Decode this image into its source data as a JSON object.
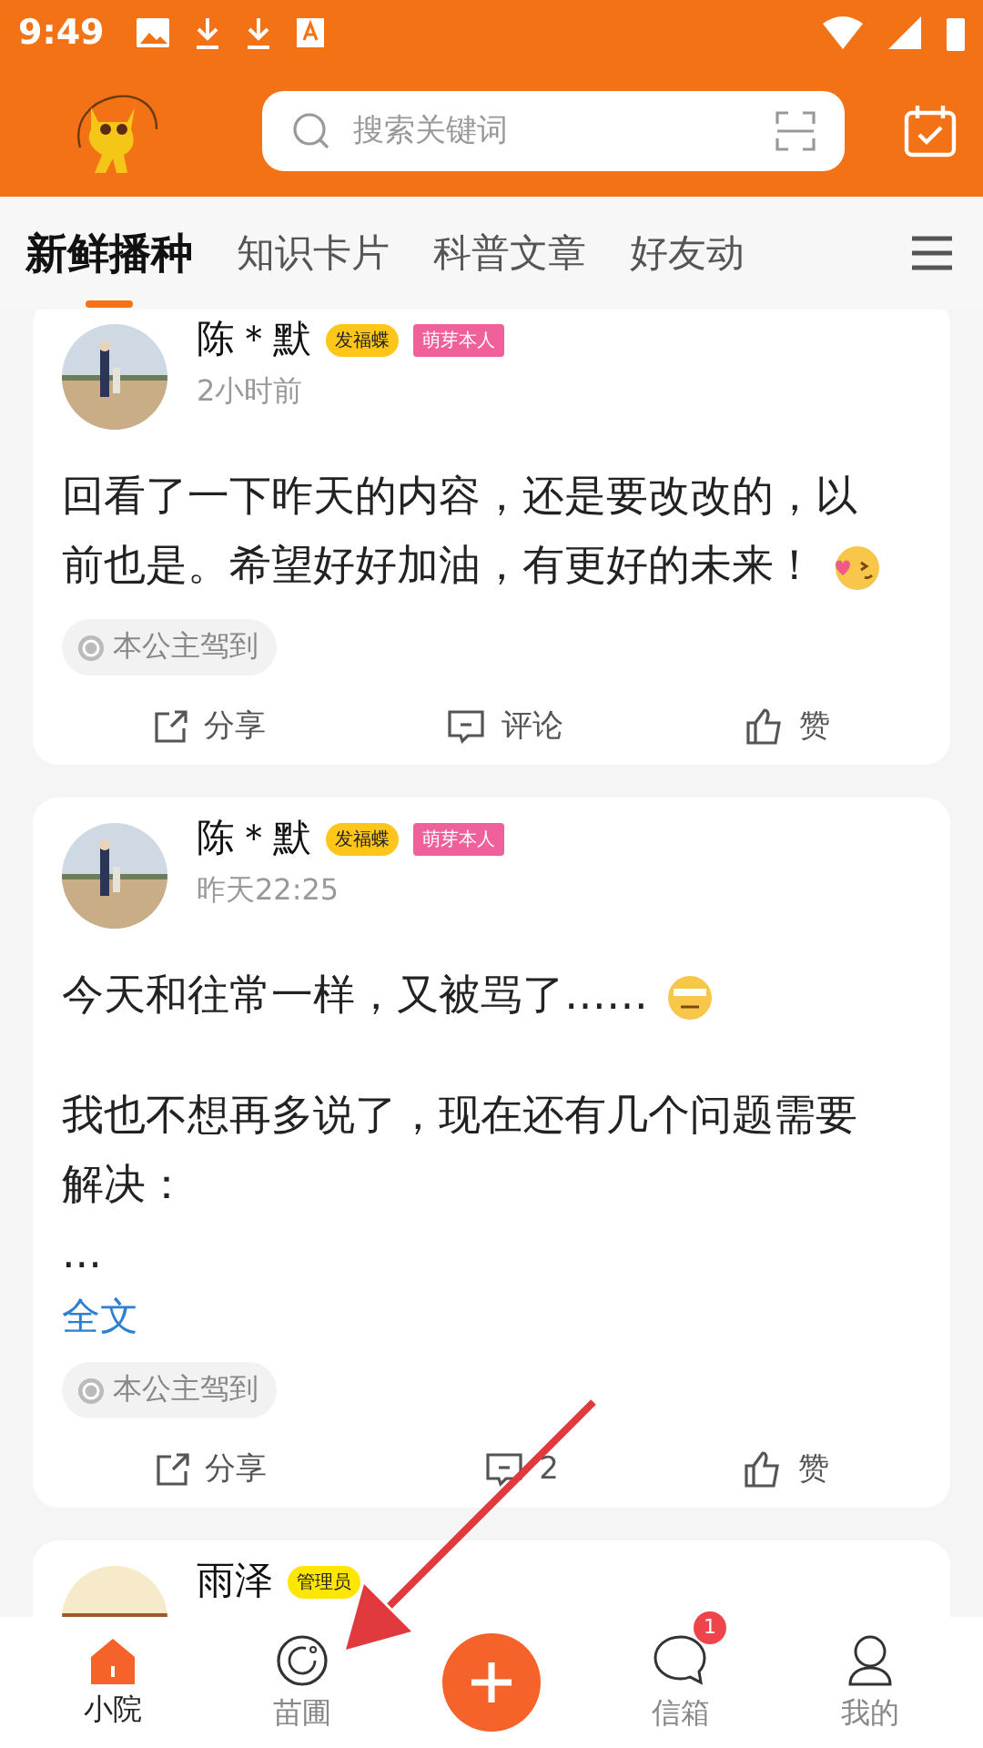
{
  "status_bar": {
    "time": "9:49"
  },
  "search": {
    "placeholder": "搜索关键词"
  },
  "tabs": [
    {
      "label": "新鲜播种",
      "selected": true
    },
    {
      "label": "知识卡片",
      "selected": false
    },
    {
      "label": "科普文章",
      "selected": false
    },
    {
      "label": "好友动",
      "selected": false
    }
  ],
  "posts": [
    {
      "author": "陈＊默",
      "badges": [
        {
          "kind": "medal",
          "label": "发福蝶"
        },
        {
          "kind": "crown",
          "label": "萌芽本人"
        }
      ],
      "time": "2小时前",
      "paragraphs": [
        {
          "text": "回看了一下昨天的内容，还是要改改的，以前也是。希望好好加油，有更好的未来！",
          "emoji": true
        }
      ],
      "tag": "本公主驾到",
      "actions": {
        "share": "分享",
        "comment": "评论",
        "like": "赞"
      }
    },
    {
      "author": "陈＊默",
      "badges": [
        {
          "kind": "medal",
          "label": "发福蝶"
        },
        {
          "kind": "crown",
          "label": "萌芽本人"
        }
      ],
      "time": "昨天22:25",
      "paragraphs": [
        {
          "text": "今天和往常一样，又被骂了……",
          "emoji": true
        },
        {
          "text": "我也不想再多说了，现在还有几个问题需要解决：\n...",
          "emoji": false
        }
      ],
      "more": "全文",
      "tag": "本公主驾到",
      "actions": {
        "share": "分享",
        "comment": "2",
        "like": "赞"
      }
    },
    {
      "author": "雨泽",
      "badges": [
        {
          "kind": "admin",
          "label": "管理员"
        }
      ]
    }
  ],
  "nav": [
    {
      "kind": "home",
      "label": "小院",
      "selected": true
    },
    {
      "kind": "nursery",
      "label": "苗圃",
      "selected": false
    },
    {
      "kind": "add"
    },
    {
      "kind": "inbox",
      "label": "信箱",
      "selected": false,
      "count": "1"
    },
    {
      "kind": "me",
      "label": "我的",
      "selected": false
    }
  ]
}
